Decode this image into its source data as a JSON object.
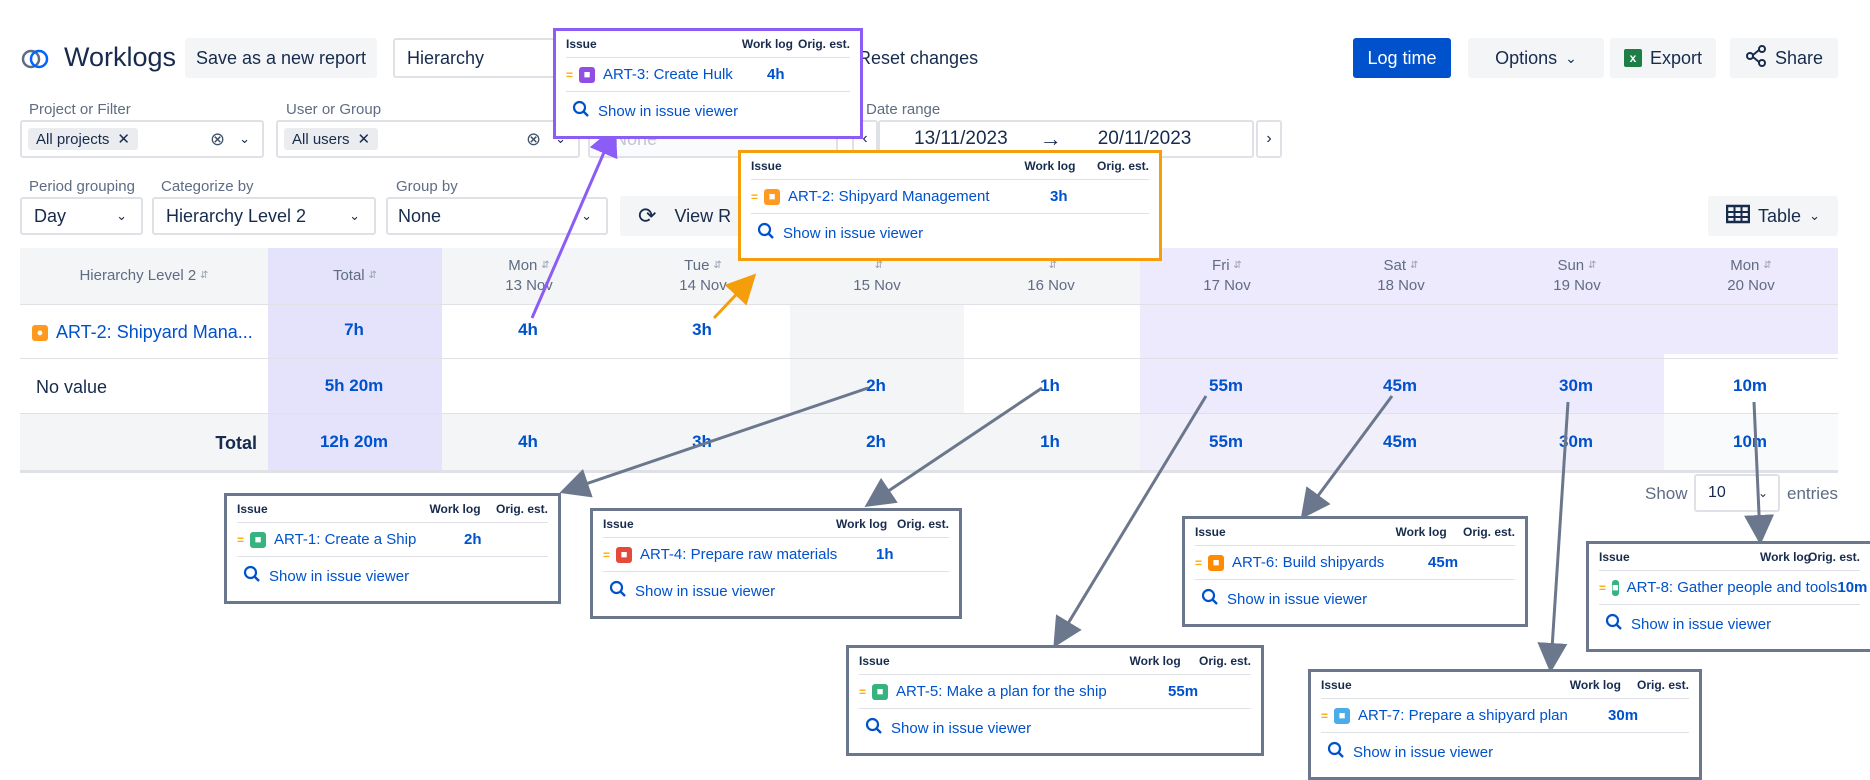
{
  "app": {
    "title": "Worklogs"
  },
  "toolbar": {
    "save_report": "Save as a new report",
    "report_type_value": "Hierarchy",
    "reset": "Reset changes",
    "log_time": "Log time",
    "options": "Options",
    "export": "Export",
    "share": "Share"
  },
  "filters": {
    "project_label": "Project or Filter",
    "project_chip": "All projects",
    "user_label": "User or Group",
    "user_chip": "All users",
    "third_placeholder": "None",
    "date_label": "Date range",
    "date_from": "13/11/2023",
    "date_to": "20/11/2023",
    "period_label": "Period grouping",
    "period_value": "Day",
    "categorize_label": "Categorize by",
    "categorize_value": "Hierarchy Level 2",
    "group_label": "Group by",
    "group_value": "None",
    "view_button": "View R",
    "table_button": "Table"
  },
  "table": {
    "col_category": "Hierarchy Level 2",
    "col_total": "Total",
    "days": [
      {
        "day": "Mon",
        "date": "13 Nov"
      },
      {
        "day": "Tue",
        "date": "14 Nov"
      },
      {
        "day": "",
        "date": "15 Nov"
      },
      {
        "day": "",
        "date": "16 Nov"
      },
      {
        "day": "Fri",
        "date": "17 Nov"
      },
      {
        "day": "Sat",
        "date": "18 Nov"
      },
      {
        "day": "Sun",
        "date": "19 Nov"
      },
      {
        "day": "Mon",
        "date": "20 Nov"
      }
    ],
    "rows": [
      {
        "label": "ART-2: Shipyard Mana...",
        "total": "7h",
        "cells": [
          "4h",
          "3h",
          "",
          "",
          "",
          "",
          "",
          ""
        ]
      },
      {
        "label": "No value",
        "total": "5h 20m",
        "cells": [
          "",
          "",
          "2h",
          "1h",
          "55m",
          "45m",
          "30m",
          "10m"
        ]
      },
      {
        "label": "Total",
        "total": "12h 20m",
        "cells": [
          "4h",
          "3h",
          "2h",
          "1h",
          "55m",
          "45m",
          "30m",
          "10m"
        ]
      }
    ]
  },
  "pagination": {
    "show": "Show",
    "value": "10",
    "entries": "entries"
  },
  "popup_headers": {
    "issue": "Issue",
    "work_log": "Work log",
    "orig_est": "Orig. est.",
    "show_in_viewer": "Show in issue viewer"
  },
  "popups": [
    {
      "issue": "ART-3: Create Hulk",
      "log": "4h",
      "border": "#8b5cf6",
      "icon": "epic-icon",
      "icon_color": "#904ee2"
    },
    {
      "issue": "ART-2: Shipyard Management",
      "log": "3h",
      "border": "#f59e0b",
      "icon": "idea-icon",
      "icon_color": "#ff991f"
    },
    {
      "issue": "ART-1: Create a Ship",
      "log": "2h",
      "border": "#6b778c",
      "icon": "improvement-icon",
      "icon_color": "#36b37e"
    },
    {
      "issue": "ART-4: Prepare raw materials",
      "log": "1h",
      "border": "#6b778c",
      "icon": "incident-icon",
      "icon_color": "#e5493a"
    },
    {
      "issue": "ART-5: Make a plan for the ship",
      "log": "55m",
      "border": "#6b778c",
      "icon": "new-feature-icon",
      "icon_color": "#36b37e"
    },
    {
      "issue": "ART-6: Build shipyards",
      "log": "45m",
      "border": "#6b778c",
      "icon": "problem-icon",
      "icon_color": "#ff8b00"
    },
    {
      "issue": "ART-7: Prepare a shipyard plan",
      "log": "30m",
      "border": "#6b778c",
      "icon": "change-icon",
      "icon_color": "#4bade8"
    },
    {
      "issue": "ART-8: Gather people and tools",
      "log": "10m",
      "border": "#6b778c",
      "icon": "service-request-icon",
      "icon_color": "#36b37e"
    }
  ],
  "colors": {
    "accent": "#0052cc",
    "highlight_col": "#e5e3fc",
    "weekend_col": "#eeeafd"
  }
}
